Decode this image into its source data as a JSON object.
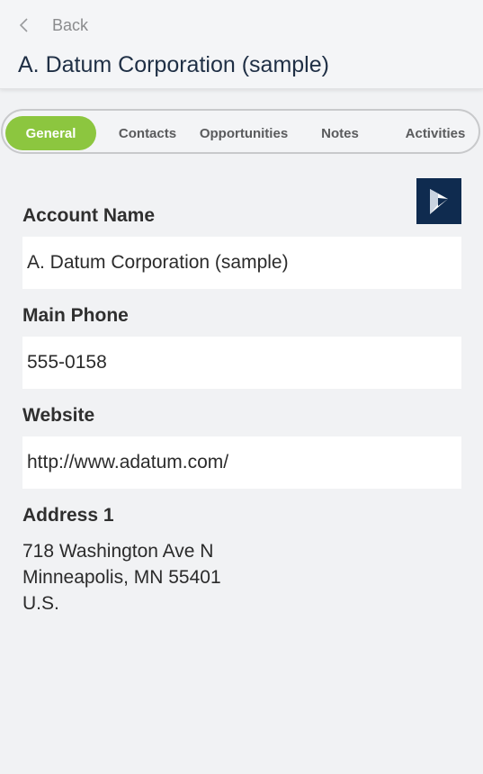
{
  "header": {
    "back_label": "Back",
    "title": "A. Datum Corporation (sample)"
  },
  "tabs": [
    {
      "label": "General",
      "active": true
    },
    {
      "label": "Contacts",
      "active": false
    },
    {
      "label": "Opportunities",
      "active": false
    },
    {
      "label": "Notes",
      "active": false
    },
    {
      "label": "Activities",
      "active": false
    }
  ],
  "logo_icon": "dynamics-logo-icon",
  "fields": {
    "account_name": {
      "label": "Account Name",
      "value": "A. Datum Corporation (sample)"
    },
    "main_phone": {
      "label": "Main Phone",
      "value": "555-0158"
    },
    "website": {
      "label": "Website",
      "value": "http://www.adatum.com/"
    },
    "address1": {
      "label": "Address 1",
      "line1": "718 Washington Ave N",
      "line2": "Minneapolis, MN 55401",
      "line3": "U.S."
    }
  },
  "colors": {
    "accent": "#8cc63f",
    "logo_bg": "#0f2b4f",
    "background": "#f1f2f4"
  }
}
